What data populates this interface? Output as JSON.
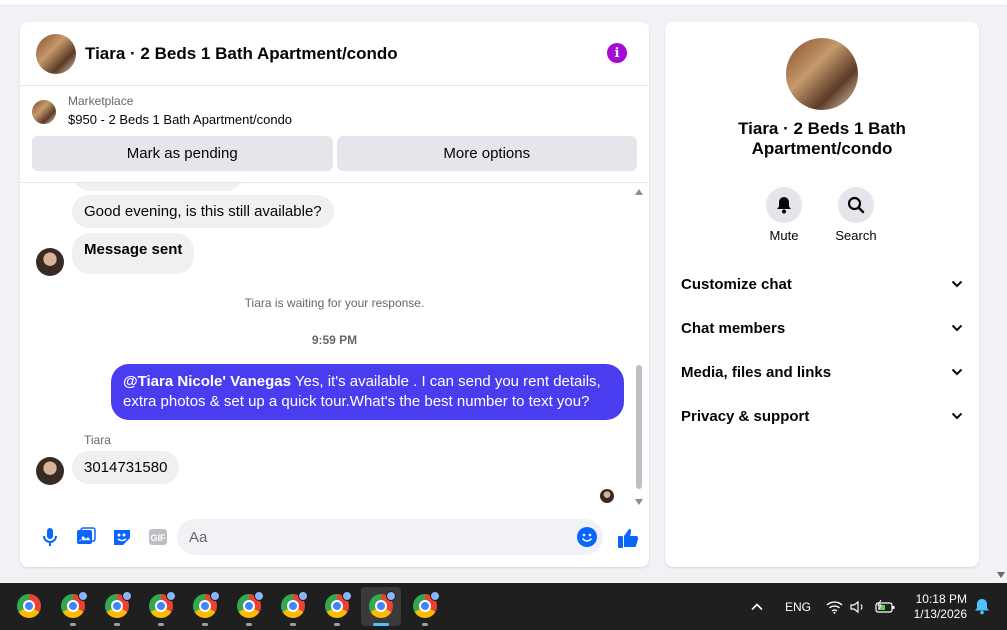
{
  "chat": {
    "title": "Tiara · 2 Beds 1 Bath Apartment/condo",
    "marketplace_label": "Marketplace",
    "listing": "$950 - 2 Beds 1 Bath Apartment/condo",
    "mark_pending": "Mark as pending",
    "more_options": "More options",
    "messages": {
      "msg1": "Good evening, is this still available?",
      "msg2": "Message sent",
      "waiting": "Tiara is waiting for your response.",
      "time": "9:59 PM",
      "out_mention": "@Tiara Nicole' Vanegas",
      "out_text": " Yes, it's available .  I can send you rent details, extra photos & set up a quick tour.What's the best number to text you?",
      "sender": "Tiara",
      "reply": "3014731580"
    },
    "input_placeholder": "Aa"
  },
  "side": {
    "name": "Tiara · 2 Beds 1 Bath Apartment/condo",
    "mute": "Mute",
    "search": "Search",
    "menu": [
      "Customize chat",
      "Chat members",
      "Media, files and links",
      "Privacy & support"
    ]
  },
  "taskbar": {
    "lang": "ENG",
    "time": "10:18 PM",
    "date": "1/13/2026"
  },
  "colors": {
    "accent": "#4a3df0",
    "info": "#a40cd5",
    "like": "#0866ff"
  }
}
